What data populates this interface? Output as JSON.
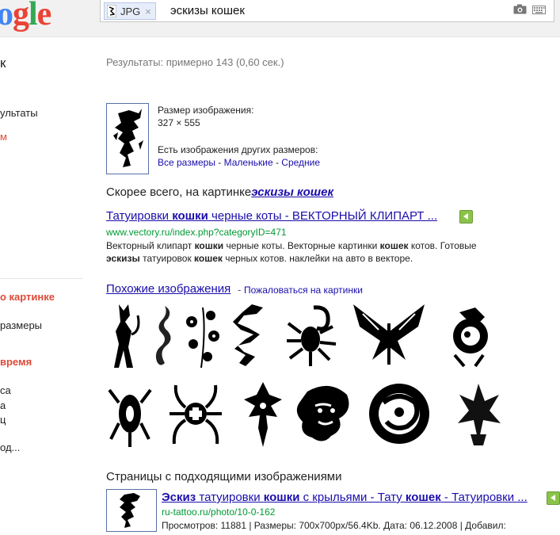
{
  "header": {
    "logo_text": "ogle",
    "chip_label": "JPG",
    "chip_close": "×",
    "query": "эскизы кошек"
  },
  "sidebar": {
    "items": [
      {
        "label": "к"
      },
      {
        "label": "ультаты"
      },
      {
        "label": "м"
      },
      {
        "label": "о картинке"
      },
      {
        "label": "размеры"
      },
      {
        "label": "время"
      },
      {
        "label": "са"
      },
      {
        "label": "а"
      },
      {
        "label": "ц"
      },
      {
        "label": "од..."
      }
    ]
  },
  "stats": "Результаты: примерно 143 (0,60 сек.)",
  "image_info": {
    "size_label": "Размер изображения:",
    "size_value": "327 × 555",
    "other_sizes": "Есть изображения других размеров:",
    "all_sizes": "Все размеры",
    "sep": " - ",
    "small": "Маленькие",
    "medium": "Средние"
  },
  "best_guess": {
    "prefix": "Скорее всего, на картинке",
    "link": "эскизы кошек"
  },
  "result1": {
    "title_a": "Татуировки ",
    "title_b": "кошки",
    "title_c": " черные коты - ВЕКТОРНЫЙ КЛИПАРТ ...",
    "url": "www.vectory.ru/index.php?categoryID=471",
    "snippet1_a": "Векторный клипарт ",
    "snippet1_b": "кошки",
    "snippet1_c": " черные коты. Векторные картинки ",
    "snippet1_d": "кошек",
    "snippet1_e": " котов. Готовые",
    "snippet2_a": "эскизы",
    "snippet2_b": " татуировок ",
    "snippet2_c": "кошек",
    "snippet2_d": " черных котов. наклейки на авто в векторе."
  },
  "similar": {
    "title": "Похожие изображения",
    "sep": " - ",
    "report": "Пожаловаться на картинки"
  },
  "pages": {
    "title": "Страницы с подходящими изображениями",
    "result_title_a": "Эскиз",
    "result_title_b": " татуировки ",
    "result_title_c": "кошки",
    "result_title_d": " с крыльями - Тату ",
    "result_title_e": "кошек",
    "result_title_f": " - Татуировки ...",
    "url": "ru-tattoo.ru/photo/10-0-162",
    "meta": "Просмотров: 11881 | Размеры: 700x700px/56.4Kb. Дата: 06.12.2008 | Добавил:"
  }
}
